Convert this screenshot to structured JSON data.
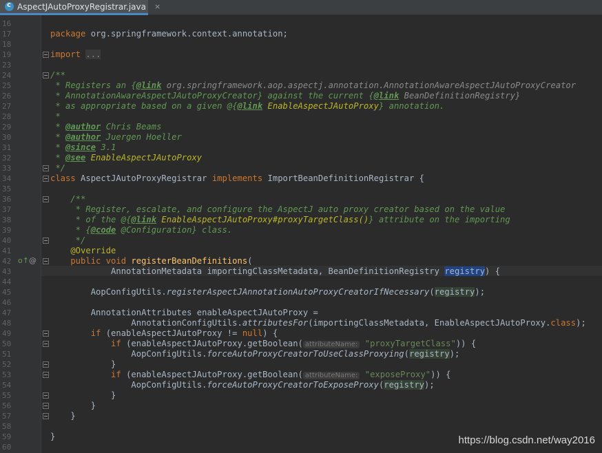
{
  "tab": {
    "title": "AspectJAutoProxyRegistrar.java",
    "icon_letter": "c",
    "close": "×"
  },
  "watermark": "https://blog.csdn.net/way2016",
  "line_numbers": [
    "16",
    "17",
    "18",
    "19",
    "23",
    "24",
    "25",
    "26",
    "27",
    "28",
    "29",
    "30",
    "31",
    "32",
    "33",
    "34",
    "35",
    "36",
    "37",
    "38",
    "39",
    "40",
    "41",
    "42",
    "43",
    "44",
    "45",
    "46",
    "47",
    "48",
    "49",
    "50",
    "51",
    "52",
    "53",
    "54",
    "55",
    "56",
    "57",
    "58",
    "59",
    "60"
  ],
  "code": {
    "l17_kw": "package",
    "l17_rest": " org.springframework.context.annotation;",
    "l19_kw": "import",
    "l19_fold": "...",
    "l24": "/**",
    "l25_a": " * Registers an {",
    "l25_tag": "@link",
    "l25_b": " org.springframework.aop.aspectj.annotation.AnnotationAwareAspectJAutoProxyCreator",
    "l26_a": " * AnnotationAwareAspectJAutoProxyCreator} against the current {",
    "l26_tag": "@link",
    "l26_b": " BeanDefinitionRegistry}",
    "l27_a": " * as appropriate based on a given @{",
    "l27_tag": "@link",
    "l27_b": " EnableAspectJAutoProxy",
    "l27_c": "} annotation.",
    "l28": " *",
    "l29_a": " * ",
    "l29_tag": "@author",
    "l29_b": " Chris Beams",
    "l30_a": " * ",
    "l30_tag": "@author",
    "l30_b": " Juergen Hoeller",
    "l31_a": " * ",
    "l31_tag": "@since",
    "l31_b": " 3.1",
    "l32_a": " * ",
    "l32_tag": "@see",
    "l32_b": " EnableAspectJAutoProxy",
    "l33": " */",
    "l34_kw1": "class",
    "l34_a": " AspectJAutoProxyRegistrar ",
    "l34_kw2": "implements",
    "l34_b": " ImportBeanDefinitionRegistrar {",
    "l36": "    /**",
    "l37": "     * Register, escalate, and configure the AspectJ auto proxy creator based on the value",
    "l38_a": "     * of the @{",
    "l38_tag": "@link",
    "l38_b": " EnableAspectJAutoProxy#proxyTargetClass()",
    "l38_c": "} attribute on the importing",
    "l39_a": "     * {",
    "l39_tag": "@code",
    "l39_b": " @Configuration} class.",
    "l40": "     */",
    "l41_ann": "    @Override",
    "l42_kw": "    public void",
    "l42_meth": " registerBeanDefinitions",
    "l42_b": "(",
    "l43_a": "            AnnotationMetadata importingClassMetadata, BeanDefinitionRegistry ",
    "l43_sel": "registry",
    "l43_b": ") {",
    "l45_a": "        AopConfigUtils.",
    "l45_static": "registerAspectJAnnotationAutoProxyCreatorIfNecessary",
    "l45_b": "(",
    "l45_hl": "registry",
    "l45_c": ");",
    "l47": "        AnnotationAttributes enableAspectJAutoProxy =",
    "l48_a": "                AnnotationConfigUtils.",
    "l48_static": "attributesFor",
    "l48_b": "(importingClassMetadata, EnableAspectJAutoProxy.",
    "l48_kw": "class",
    "l48_c": ");",
    "l49_kw": "        if",
    "l49_a": " (enableAspectJAutoProxy != ",
    "l49_kw2": "null",
    "l49_b": ") {",
    "l50_kw": "            if",
    "l50_a": " (enableAspectJAutoProxy.getBoolean(",
    "l50_hint": "attributeName:",
    "l50_str": " \"proxyTargetClass\"",
    "l50_b": ")) {",
    "l51_a": "                AopConfigUtils.",
    "l51_static": "forceAutoProxyCreatorToUseClassProxying",
    "l51_b": "(",
    "l51_hl": "registry",
    "l51_c": ");",
    "l52": "            }",
    "l53_kw": "            if",
    "l53_a": " (enableAspectJAutoProxy.getBoolean(",
    "l53_hint": "attributeName:",
    "l53_str": " \"exposeProxy\"",
    "l53_b": ")) {",
    "l54_a": "                AopConfigUtils.",
    "l54_static": "forceAutoProxyCreatorToExposeProxy",
    "l54_b": "(",
    "l54_hl": "registry",
    "l54_c": ");",
    "l55": "            }",
    "l56": "        }",
    "l57": "    }",
    "l59": "}"
  },
  "colors": {
    "background": "#2b2b2b",
    "keyword": "#cc7832",
    "doc": "#629755",
    "method": "#ffc66d",
    "annotation": "#bbb529",
    "string": "#6a8759",
    "selection": "#214283"
  },
  "gutter_icons": {
    "implements": "o↑",
    "annotation": "@"
  }
}
